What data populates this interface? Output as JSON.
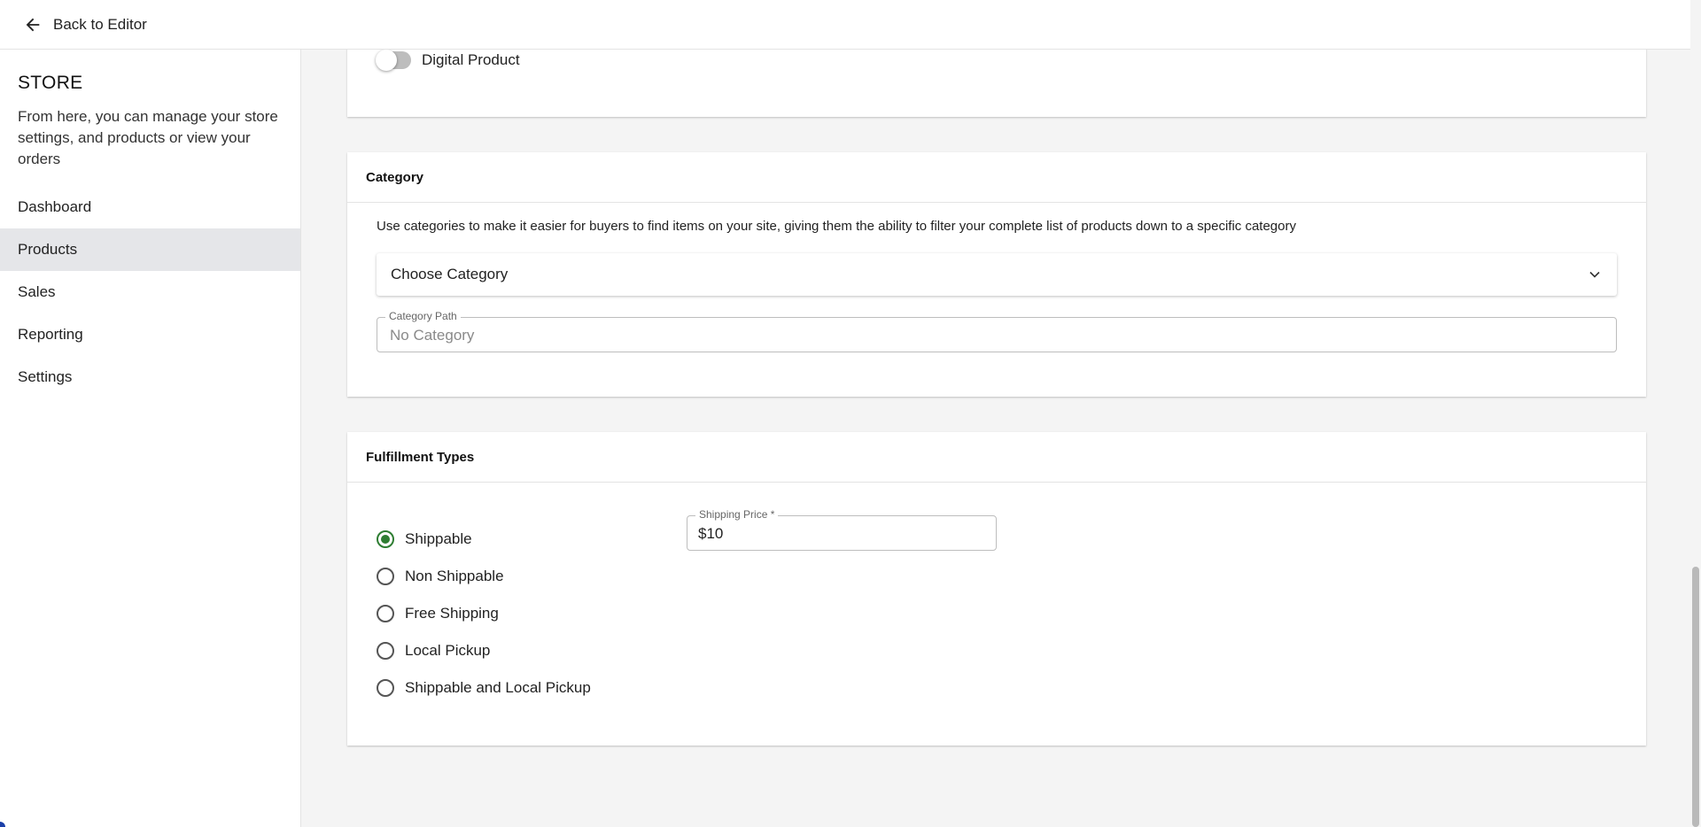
{
  "topbar": {
    "back_label": "Back to Editor",
    "back_icon": "arrow-left-icon"
  },
  "sidebar": {
    "title": "STORE",
    "description": "From here, you can manage your store settings, and products or view your orders",
    "items": [
      {
        "label": "Dashboard",
        "active": false
      },
      {
        "label": "Products",
        "active": true
      },
      {
        "label": "Sales",
        "active": false
      },
      {
        "label": "Reporting",
        "active": false
      },
      {
        "label": "Settings",
        "active": false
      }
    ]
  },
  "digital_product": {
    "label": "Digital Product",
    "on": false
  },
  "category": {
    "header": "Category",
    "description": "Use categories to make it easier for buyers to find items on your site, giving them the ability to filter your complete list of products down to a specific category",
    "select_label": "Choose Category",
    "path_label": "Category Path",
    "path_value": "No Category"
  },
  "fulfillment": {
    "header": "Fulfillment Types",
    "options": [
      {
        "label": "Shippable",
        "checked": true
      },
      {
        "label": "Non Shippable",
        "checked": false
      },
      {
        "label": "Free Shipping",
        "checked": false
      },
      {
        "label": "Local Pickup",
        "checked": false
      },
      {
        "label": "Shippable and Local Pickup",
        "checked": false
      }
    ],
    "shipping_price_label": "Shipping Price *",
    "shipping_price_value": "$10"
  },
  "colors": {
    "accent_green": "#2e7d32",
    "active_nav_bg": "#e5e6e9"
  }
}
